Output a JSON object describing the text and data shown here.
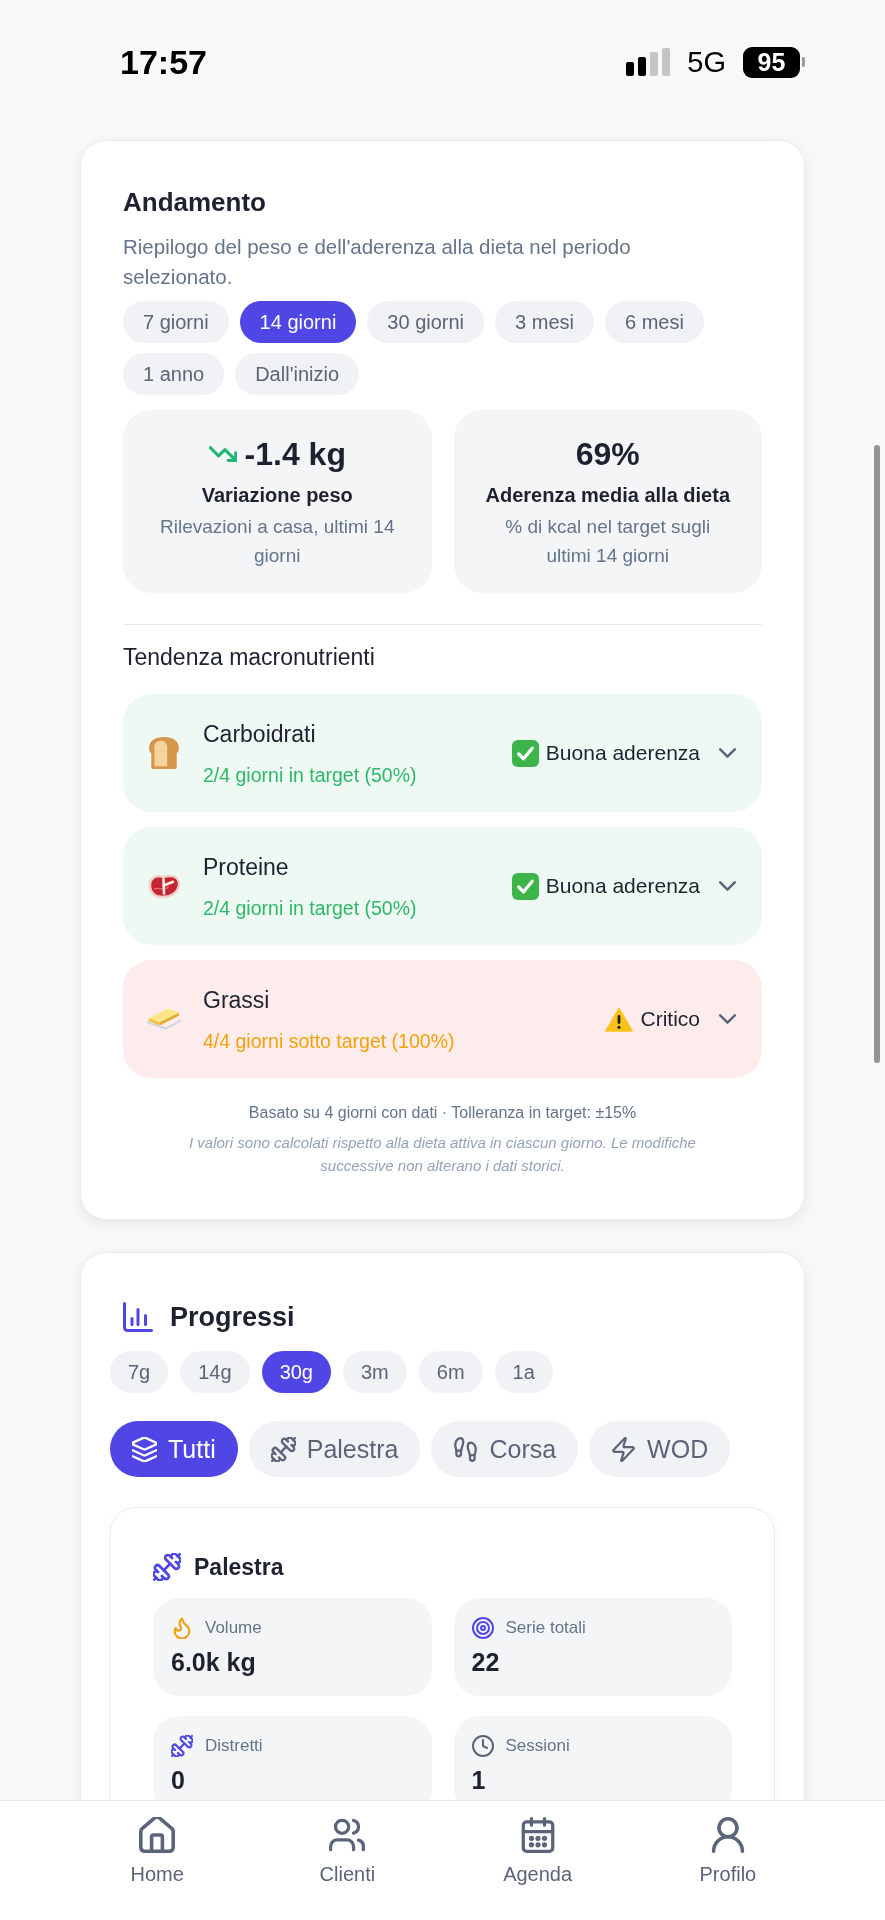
{
  "status_bar": {
    "time": "17:57",
    "network": "5G",
    "battery": "95"
  },
  "trend_card": {
    "title": "Andamento",
    "description": "Riepilogo del peso e dell'aderenza alla dieta nel periodo selezionato.",
    "periods": [
      {
        "label": "7 giorni",
        "selected": false
      },
      {
        "label": "14 giorni",
        "selected": true
      },
      {
        "label": "30 giorni",
        "selected": false
      },
      {
        "label": "3 mesi",
        "selected": false
      },
      {
        "label": "6 mesi",
        "selected": false
      },
      {
        "label": "1 anno",
        "selected": false
      },
      {
        "label": "Dall'inizio",
        "selected": false
      }
    ],
    "stats": [
      {
        "kind": "decrease",
        "value": "-1.4 kg",
        "label": "Variazione peso",
        "caption": "Rilevazioni a casa, ultimi 14 giorni"
      },
      {
        "kind": "average",
        "value": "69%",
        "label": "Aderenza media alla dieta",
        "caption": "% di kcal nel target sugli ultimi 14 giorni"
      }
    ],
    "macros": {
      "title": "Tendenza macronutrienti",
      "items": [
        {
          "kind": "carbs",
          "name": "Carboidrati",
          "detail": "2/4 giorni in target (50%)",
          "badge": {
            "kind": "good",
            "label": "Buona aderenza"
          },
          "expanded": false
        },
        {
          "kind": "protein",
          "name": "Proteine",
          "detail": "2/4 giorni in target (50%)",
          "badge": {
            "kind": "good",
            "label": "Buona aderenza"
          },
          "expanded": false
        },
        {
          "kind": "fat",
          "name": "Grassi",
          "detail": "4/4 giorni sotto target (100%)",
          "badge": {
            "kind": "critical",
            "label": "Critico"
          },
          "expanded": false
        }
      ]
    },
    "summary": "Basato su 4 giorni con dati · Tolleranza in target: ±15%",
    "note": "I valori sono calcolati rispetto alla dieta attiva in ciascun giorno. Le modifiche successive non alterano i dati storici."
  },
  "progress_card": {
    "title": "Progressi",
    "periods": [
      {
        "label": "7g",
        "selected": false
      },
      {
        "label": "14g",
        "selected": false
      },
      {
        "label": "30g",
        "selected": true
      },
      {
        "label": "3m",
        "selected": false
      },
      {
        "label": "6m",
        "selected": false
      },
      {
        "label": "1a",
        "selected": false
      }
    ],
    "filters": [
      {
        "kind": "all",
        "label": "Tutti",
        "selected": true
      },
      {
        "kind": "gym",
        "label": "Palestra",
        "selected": false
      },
      {
        "kind": "run",
        "label": "Corsa",
        "selected": false
      },
      {
        "kind": "wod",
        "label": "WOD",
        "selected": false
      }
    ],
    "section": {
      "kind": "gym",
      "title": "Palestra",
      "metrics": [
        {
          "kind": "volume",
          "label": "Volume",
          "value": "6.0k kg"
        },
        {
          "kind": "sets",
          "label": "Serie totali",
          "value": "22"
        },
        {
          "kind": "districts",
          "label": "Distretti",
          "value": "0"
        },
        {
          "kind": "sessions",
          "label": "Sessioni",
          "value": "1"
        }
      ]
    }
  },
  "nav": [
    {
      "kind": "home",
      "label": "Home",
      "selected": false
    },
    {
      "kind": "clients",
      "label": "Clienti",
      "selected": false
    },
    {
      "kind": "agenda",
      "label": "Agenda",
      "selected": false
    },
    {
      "kind": "profile",
      "label": "Profilo",
      "selected": false
    }
  ]
}
